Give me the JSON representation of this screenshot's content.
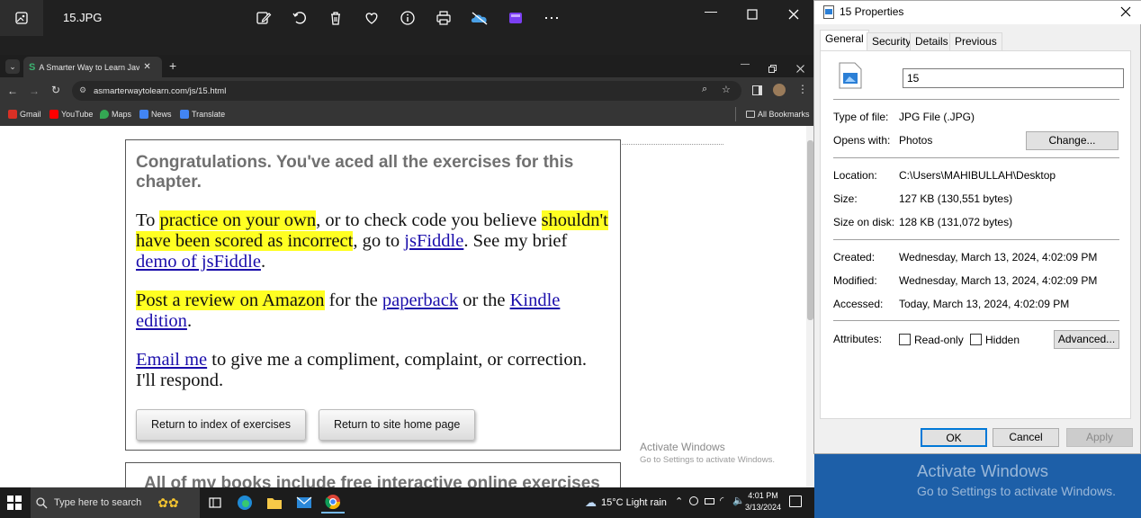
{
  "photos": {
    "title": "15.JPG"
  },
  "chrome": {
    "tab_title": "A Smarter Way to Learn JavaScript",
    "url": "asmarterwaytolearn.com/js/15.html",
    "bookmarks": [
      {
        "label": "Gmail",
        "color": "#d93025"
      },
      {
        "label": "YouTube",
        "color": "#ff0000"
      },
      {
        "label": "Maps",
        "color": "#34a853"
      },
      {
        "label": "News",
        "color": "#4285f4"
      },
      {
        "label": "Translate",
        "color": "#4285f4"
      }
    ],
    "all_bookmarks": "All Bookmarks"
  },
  "page": {
    "congrats": "Congratulations. You've aced all the exercises for this chapter.",
    "p1": {
      "a": "To ",
      "hl1": "practice on your own",
      "b": ", or to check code you believe ",
      "hl2": "shouldn't have been scored as incorrect",
      "c": ", go to ",
      "link1": "jsFiddle",
      "d": ". See my brief ",
      "link2": "demo of jsFiddle",
      "e": "."
    },
    "p2": {
      "hl": "Post a review on Amazon",
      "a": " for the ",
      "link1": "paperback",
      "b": " or the ",
      "link2": "Kindle edition",
      "c": "."
    },
    "p3": {
      "link": "Email me",
      "a": " to give me a compliment, complaint, or correction. I'll respond."
    },
    "btn_index": "Return to index of exercises",
    "btn_home": "Return to site home page",
    "card2_text": "All of my books include free interactive online exercises",
    "watermark_line1": "Activate Windows",
    "watermark_line2": "Go to Settings to activate Windows."
  },
  "props": {
    "title": "15 Properties",
    "tabs": [
      "General",
      "Security",
      "Details",
      "Previous Versions"
    ],
    "filename": "15",
    "type_label": "Type of file:",
    "type_value": "JPG File (.JPG)",
    "opens_label": "Opens with:",
    "opens_value": "Photos",
    "change_btn": "Change...",
    "location_label": "Location:",
    "location_value": "C:\\Users\\MAHIBULLAH\\Desktop",
    "size_label": "Size:",
    "size_value": "127 KB (130,551 bytes)",
    "disk_label": "Size on disk:",
    "disk_value": "128 KB (131,072 bytes)",
    "created_label": "Created:",
    "created_value": "Wednesday, March 13, 2024, 4:02:09 PM",
    "modified_label": "Modified:",
    "modified_value": "Wednesday, March 13, 2024, 4:02:09 PM",
    "accessed_label": "Accessed:",
    "accessed_value": "Today, March 13, 2024, 4:02:09 PM",
    "attributes_label": "Attributes:",
    "readonly_label": "Read-only",
    "hidden_label": "Hidden",
    "advanced_btn": "Advanced...",
    "ok_btn": "OK",
    "cancel_btn": "Cancel",
    "apply_btn": "Apply"
  },
  "desktop": {
    "watermark_line1": "Activate Windows",
    "watermark_line2": "Go to Settings to activate Windows."
  },
  "taskbar": {
    "search_placeholder": "Type here to search",
    "weather": "15°C  Light rain",
    "time": "4:01 PM",
    "date": "3/13/2024"
  }
}
